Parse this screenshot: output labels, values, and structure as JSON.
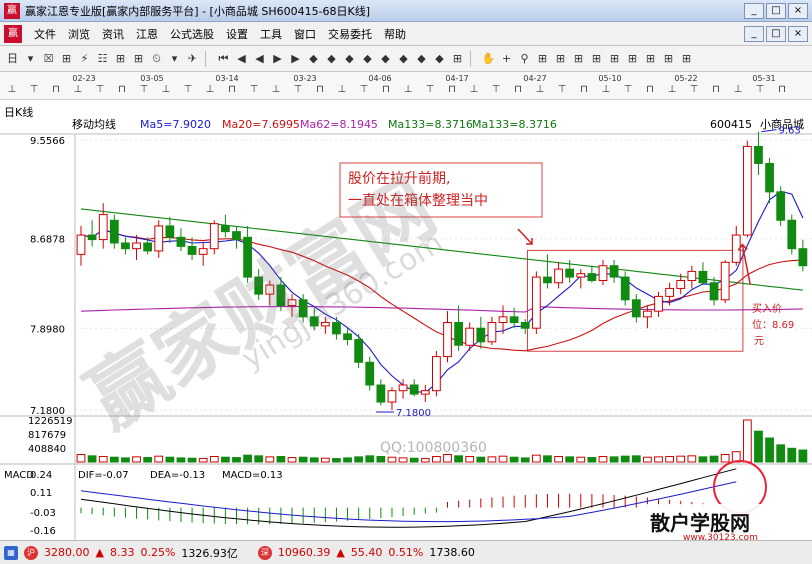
{
  "window": {
    "title": "赢家江恩专业版[赢家内部服务平台] - [小商品城  SH600415-68日K线]",
    "buttons": [
      "_",
      "□",
      "×"
    ]
  },
  "menu": {
    "items": [
      "文件",
      "浏览",
      "资讯",
      "江恩",
      "公式选股",
      "设置",
      "工具",
      "窗口",
      "交易委托",
      "帮助"
    ],
    "mdi_buttons": [
      "_",
      "□",
      "×"
    ]
  },
  "toolbar": {
    "groups": [
      [
        "日",
        "▾",
        "☒",
        "⊞",
        "⚡",
        "☷",
        "⊞",
        "⊞",
        "⏲",
        "▾",
        "✈"
      ],
      [
        "⏮",
        "◀",
        "◀",
        "▶",
        "▶",
        "◆",
        "◆",
        "◆",
        "◆",
        "◆",
        "◆",
        "◆",
        "◆",
        "⊞"
      ],
      [
        "✋",
        "+",
        "⚲",
        "⊞",
        "⊞",
        "⊞",
        "⊞",
        "⊞",
        "⊞",
        "⊞",
        "⊞",
        "⊞"
      ]
    ]
  },
  "date_strip": {
    "labels": [
      "02-23",
      "03-05",
      "03-14",
      "03-23",
      "04-06",
      "04-17",
      "04-27",
      "05-10",
      "05-22",
      "05-31"
    ]
  },
  "chart_header": {
    "period": "日K线",
    "indicator": "移动均线",
    "ma5": "Ma5=7.9020",
    "ma20": "Ma20=7.6995",
    "ma62": "Ma62=8.1945",
    "ma133a": "Ma133=8.3716",
    "ma133b": "Ma133=8.3716",
    "code": "600415",
    "name": "小商品城"
  },
  "price_axis": {
    "labels": [
      "9.5566",
      "8.6878",
      "7.8980",
      "7.1800"
    ],
    "high_marker": "9.63",
    "low_marker": "7.1800"
  },
  "volume_axis": {
    "labels": [
      "1226519",
      "817679",
      "408840"
    ]
  },
  "macd": {
    "title": "MACD",
    "dif": "DIF=-0.07",
    "dea": "DEA=-0.13",
    "macd": "MACD=0.13",
    "axis_labels": [
      "0.24",
      "0.11",
      "-0.03",
      "-0.16"
    ]
  },
  "annotations": {
    "box_text_line1": "股价在拉升前期,",
    "box_text_line2": "一直处在箱体整理当中",
    "buy_label_1": "买入价",
    "buy_label_2": "位：8.69",
    "buy_label_3": "元"
  },
  "watermarks": {
    "main": "赢家财富网",
    "url": "yingjia360.com",
    "qq": "QQ:100800360",
    "stamp_site": "散户学股网",
    "stamp_url": "www.30123.com"
  },
  "status_bar": {
    "sh_index": "3280.00",
    "sh_change": "8.33",
    "sh_pct": "0.25%",
    "sh_amount": "1326.93亿",
    "sz_index": "10960.39",
    "sz_change": "55.40",
    "sz_pct": "0.51%",
    "sz_amount": "1738.60"
  },
  "chart_data": {
    "type": "candlestick",
    "symbol": "SH600415",
    "name": "小商品城",
    "candles": [
      {
        "o": 8.55,
        "h": 8.8,
        "l": 8.45,
        "c": 8.72
      },
      {
        "o": 8.72,
        "h": 8.85,
        "l": 8.62,
        "c": 8.68
      },
      {
        "o": 8.68,
        "h": 9.0,
        "l": 8.6,
        "c": 8.9
      },
      {
        "o": 8.85,
        "h": 8.9,
        "l": 8.6,
        "c": 8.65
      },
      {
        "o": 8.65,
        "h": 8.7,
        "l": 8.55,
        "c": 8.6
      },
      {
        "o": 8.6,
        "h": 8.72,
        "l": 8.5,
        "c": 8.65
      },
      {
        "o": 8.65,
        "h": 8.7,
        "l": 8.55,
        "c": 8.58
      },
      {
        "o": 8.58,
        "h": 8.85,
        "l": 8.52,
        "c": 8.8
      },
      {
        "o": 8.8,
        "h": 8.88,
        "l": 8.65,
        "c": 8.7
      },
      {
        "o": 8.7,
        "h": 8.78,
        "l": 8.58,
        "c": 8.62
      },
      {
        "o": 8.62,
        "h": 8.7,
        "l": 8.5,
        "c": 8.55
      },
      {
        "o": 8.55,
        "h": 8.65,
        "l": 8.45,
        "c": 8.6
      },
      {
        "o": 8.6,
        "h": 8.85,
        "l": 8.55,
        "c": 8.82
      },
      {
        "o": 8.8,
        "h": 8.9,
        "l": 8.7,
        "c": 8.75
      },
      {
        "o": 8.75,
        "h": 8.8,
        "l": 8.6,
        "c": 8.68
      },
      {
        "o": 8.7,
        "h": 8.8,
        "l": 8.3,
        "c": 8.35
      },
      {
        "o": 8.35,
        "h": 8.42,
        "l": 8.15,
        "c": 8.2
      },
      {
        "o": 8.2,
        "h": 8.32,
        "l": 8.1,
        "c": 8.28
      },
      {
        "o": 8.28,
        "h": 8.35,
        "l": 8.05,
        "c": 8.1
      },
      {
        "o": 8.1,
        "h": 8.2,
        "l": 8.0,
        "c": 8.15
      },
      {
        "o": 8.15,
        "h": 8.2,
        "l": 7.95,
        "c": 8.0
      },
      {
        "o": 8.0,
        "h": 8.08,
        "l": 7.88,
        "c": 7.92
      },
      {
        "o": 7.92,
        "h": 8.0,
        "l": 7.85,
        "c": 7.95
      },
      {
        "o": 7.95,
        "h": 8.0,
        "l": 7.8,
        "c": 7.85
      },
      {
        "o": 7.85,
        "h": 7.9,
        "l": 7.75,
        "c": 7.8
      },
      {
        "o": 7.8,
        "h": 7.85,
        "l": 7.55,
        "c": 7.6
      },
      {
        "o": 7.6,
        "h": 7.65,
        "l": 7.35,
        "c": 7.4
      },
      {
        "o": 7.4,
        "h": 7.45,
        "l": 7.22,
        "c": 7.25
      },
      {
        "o": 7.25,
        "h": 7.38,
        "l": 7.18,
        "c": 7.35
      },
      {
        "o": 7.35,
        "h": 7.45,
        "l": 7.28,
        "c": 7.4
      },
      {
        "o": 7.4,
        "h": 7.45,
        "l": 7.3,
        "c": 7.32
      },
      {
        "o": 7.32,
        "h": 7.4,
        "l": 7.25,
        "c": 7.35
      },
      {
        "o": 7.35,
        "h": 7.7,
        "l": 7.3,
        "c": 7.65
      },
      {
        "o": 7.65,
        "h": 8.05,
        "l": 7.6,
        "c": 7.95
      },
      {
        "o": 7.95,
        "h": 8.1,
        "l": 7.7,
        "c": 7.75
      },
      {
        "o": 7.75,
        "h": 7.95,
        "l": 7.7,
        "c": 7.9
      },
      {
        "o": 7.9,
        "h": 8.0,
        "l": 7.72,
        "c": 7.78
      },
      {
        "o": 7.78,
        "h": 8.0,
        "l": 7.75,
        "c": 7.95
      },
      {
        "o": 7.95,
        "h": 8.1,
        "l": 7.85,
        "c": 8.0
      },
      {
        "o": 8.0,
        "h": 8.08,
        "l": 7.9,
        "c": 7.95
      },
      {
        "o": 7.95,
        "h": 7.98,
        "l": 7.85,
        "c": 7.9
      },
      {
        "o": 7.9,
        "h": 8.4,
        "l": 7.85,
        "c": 8.35
      },
      {
        "o": 8.35,
        "h": 8.55,
        "l": 8.25,
        "c": 8.3
      },
      {
        "o": 8.3,
        "h": 8.48,
        "l": 8.25,
        "c": 8.42
      },
      {
        "o": 8.42,
        "h": 8.5,
        "l": 8.3,
        "c": 8.35
      },
      {
        "o": 8.35,
        "h": 8.42,
        "l": 8.25,
        "c": 8.38
      },
      {
        "o": 8.38,
        "h": 8.45,
        "l": 8.3,
        "c": 8.32
      },
      {
        "o": 8.32,
        "h": 8.5,
        "l": 8.28,
        "c": 8.45
      },
      {
        "o": 8.45,
        "h": 8.5,
        "l": 8.3,
        "c": 8.35
      },
      {
        "o": 8.35,
        "h": 8.4,
        "l": 8.1,
        "c": 8.15
      },
      {
        "o": 8.15,
        "h": 8.2,
        "l": 7.95,
        "c": 8.0
      },
      {
        "o": 8.0,
        "h": 8.1,
        "l": 7.9,
        "c": 8.05
      },
      {
        "o": 8.05,
        "h": 8.22,
        "l": 8.0,
        "c": 8.18
      },
      {
        "o": 8.18,
        "h": 8.3,
        "l": 8.1,
        "c": 8.25
      },
      {
        "o": 8.25,
        "h": 8.38,
        "l": 8.2,
        "c": 8.32
      },
      {
        "o": 8.32,
        "h": 8.45,
        "l": 8.25,
        "c": 8.4
      },
      {
        "o": 8.4,
        "h": 8.48,
        "l": 8.28,
        "c": 8.3
      },
      {
        "o": 8.3,
        "h": 8.35,
        "l": 8.1,
        "c": 8.15
      },
      {
        "o": 8.15,
        "h": 8.5,
        "l": 8.12,
        "c": 8.48
      },
      {
        "o": 8.48,
        "h": 8.8,
        "l": 8.45,
        "c": 8.72
      },
      {
        "o": 8.72,
        "h": 9.55,
        "l": 8.7,
        "c": 9.5
      },
      {
        "o": 9.5,
        "h": 9.63,
        "l": 9.25,
        "c": 9.35
      },
      {
        "o": 9.35,
        "h": 9.4,
        "l": 9.0,
        "c": 9.1
      },
      {
        "o": 9.1,
        "h": 9.15,
        "l": 8.8,
        "c": 8.85
      },
      {
        "o": 8.85,
        "h": 8.9,
        "l": 8.55,
        "c": 8.6
      },
      {
        "o": 8.6,
        "h": 8.68,
        "l": 8.4,
        "c": 8.45
      }
    ],
    "volume": [
      220000,
      180000,
      160000,
      140000,
      120000,
      150000,
      130000,
      170000,
      140000,
      120000,
      110000,
      100000,
      160000,
      140000,
      130000,
      200000,
      180000,
      150000,
      160000,
      130000,
      140000,
      120000,
      110000,
      100000,
      120000,
      150000,
      180000,
      160000,
      140000,
      120000,
      110000,
      100000,
      160000,
      220000,
      180000,
      160000,
      140000,
      150000,
      170000,
      140000,
      120000,
      200000,
      180000,
      160000,
      150000,
      140000,
      130000,
      160000,
      150000,
      170000,
      180000,
      140000,
      150000,
      160000,
      170000,
      180000,
      150000,
      170000,
      220000,
      300000,
      1226519,
      900000,
      700000,
      500000,
      400000,
      350000
    ],
    "ylim": [
      7.18,
      9.5566
    ],
    "annotation_box": {
      "from_index": 41,
      "to_index": 59,
      "low": 7.75,
      "high": 8.55
    },
    "buy_point": {
      "index": 59,
      "price": 8.69
    }
  }
}
